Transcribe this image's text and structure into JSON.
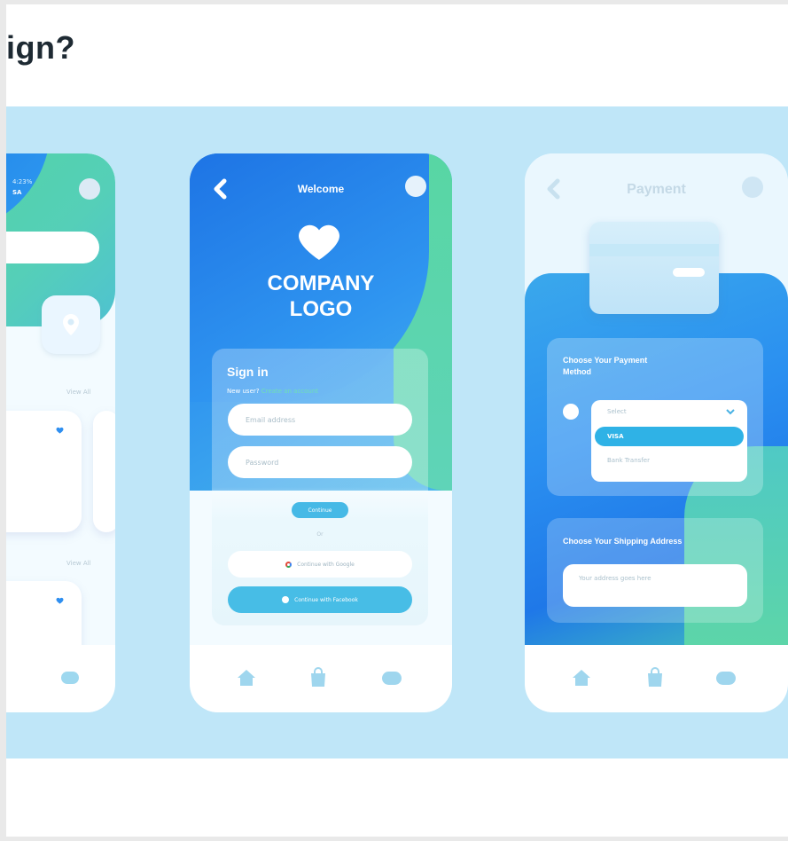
{
  "heading": {
    "text": "ign?"
  },
  "left_phone": {
    "corner_text_1": "4:23%",
    "corner_text_2": "SA",
    "view_all_1": "View All",
    "view_all_2": "View All"
  },
  "signin_phone": {
    "title": "Welcome",
    "logo_line1": "COMPANY",
    "logo_line2": "LOGO",
    "signin_title": "Sign in",
    "new_user_text": "New user?",
    "create_account_link": "Create an account",
    "email_placeholder": "Email address",
    "password_placeholder": "Password",
    "continue_label": "Continue",
    "or_text": "Or",
    "google_label": "Continue with Google",
    "facebook_label": "Continue with Facebook"
  },
  "payment_phone": {
    "title": "Payment",
    "method_title_1": "Choose Your Payment",
    "method_title_2": "Method",
    "select_placeholder": "Select",
    "option_visa": "VISA",
    "option_bank": "Bank Transfer",
    "shipping_title": "Choose Your Shipping Address",
    "address_placeholder": "Your address goes here"
  },
  "colors": {
    "panel_bg": "#bfe6f8",
    "blue_primary": "#2d8df0",
    "green_accent": "#5fd6a0",
    "cyan_button": "#47bde6"
  }
}
